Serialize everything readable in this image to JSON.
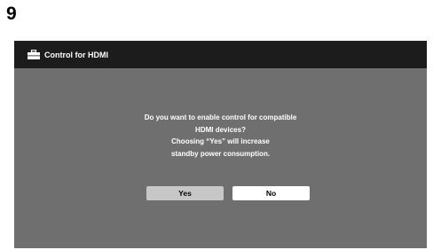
{
  "step_number": "9",
  "dialog": {
    "title": "Control for HDMI",
    "title_icon": "toolbox-icon",
    "message_lines": [
      "Do you want to enable control for compatible",
      "HDMI devices?",
      "Choosing “Yes” will increase",
      "standby power consumption."
    ],
    "buttons": {
      "yes_label": "Yes",
      "no_label": "No"
    }
  },
  "colors": {
    "screen_background": "#6f6f6f",
    "title_bar": "#1c1c1c",
    "yes_button": "#c7c7c7",
    "no_button": "#ffffff"
  }
}
